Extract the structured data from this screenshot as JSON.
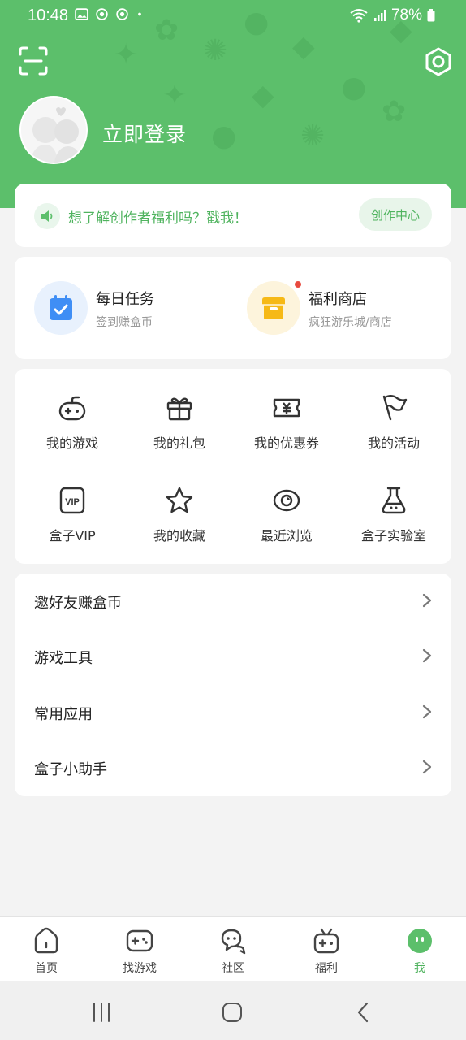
{
  "status_bar": {
    "time": "10:48",
    "battery": "78%"
  },
  "profile": {
    "login_label": "立即登录"
  },
  "notice": {
    "text": "想了解创作者福利吗？戳我！",
    "button": "创作中心"
  },
  "tasks": [
    {
      "title": "每日任务",
      "subtitle": "签到赚盒币",
      "icon": "calendar-check-icon"
    },
    {
      "title": "福利商店",
      "subtitle": "疯狂游乐城/商店",
      "icon": "store-icon"
    }
  ],
  "grid": [
    {
      "label": "我的游戏",
      "icon": "gamepad-icon"
    },
    {
      "label": "我的礼包",
      "icon": "gift-icon"
    },
    {
      "label": "我的优惠券",
      "icon": "coupon-icon"
    },
    {
      "label": "我的活动",
      "icon": "flag-icon"
    },
    {
      "label": "盒子VIP",
      "icon": "vip-icon"
    },
    {
      "label": "我的收藏",
      "icon": "star-icon"
    },
    {
      "label": "最近浏览",
      "icon": "eye-icon"
    },
    {
      "label": "盒子实验室",
      "icon": "flask-icon"
    }
  ],
  "menu": [
    {
      "label": "邀好友赚盒币"
    },
    {
      "label": "游戏工具"
    },
    {
      "label": "常用应用"
    },
    {
      "label": "盒子小助手"
    }
  ],
  "tabs": [
    {
      "label": "首页",
      "icon": "home-icon"
    },
    {
      "label": "找游戏",
      "icon": "gamepad-icon"
    },
    {
      "label": "社区",
      "icon": "chat-icon"
    },
    {
      "label": "福利",
      "icon": "gift-box-icon"
    },
    {
      "label": "我",
      "icon": "me-icon",
      "active": true
    }
  ],
  "colors": {
    "brand": "#5cbf6b",
    "accent_text": "#4fb35e",
    "badge_red": "#e84a3f"
  }
}
